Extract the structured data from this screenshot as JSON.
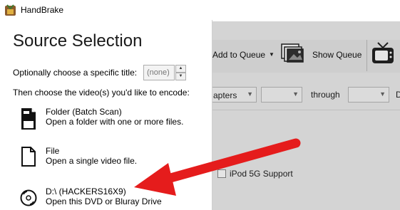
{
  "app": {
    "title": "HandBrake"
  },
  "source_panel": {
    "title": "Source Selection",
    "title_prompt": "Optionally choose a specific title:",
    "title_value": "(none)",
    "choose_prompt": "Then choose the video(s) you'd like to encode:",
    "options": [
      {
        "name": "Folder (Batch Scan)",
        "description": "Open a folder with one or more files.",
        "icon": "folder-icon"
      },
      {
        "name": "File",
        "description": "Open a single video file.",
        "icon": "file-icon"
      },
      {
        "name": "D:\\ (HACKERS16X9)",
        "description": "Open this DVD or Bluray Drive",
        "icon": "disc-icon"
      }
    ]
  },
  "main_window": {
    "toolbar": {
      "add_to_queue": "Add to Queue",
      "show_queue": "Show Queue"
    },
    "range": {
      "mode": "apters",
      "through": "through",
      "trailing": "D"
    },
    "ipod_label": "iPod 5G Support"
  },
  "annotation": {
    "arrow_color": "#e51c1c"
  }
}
